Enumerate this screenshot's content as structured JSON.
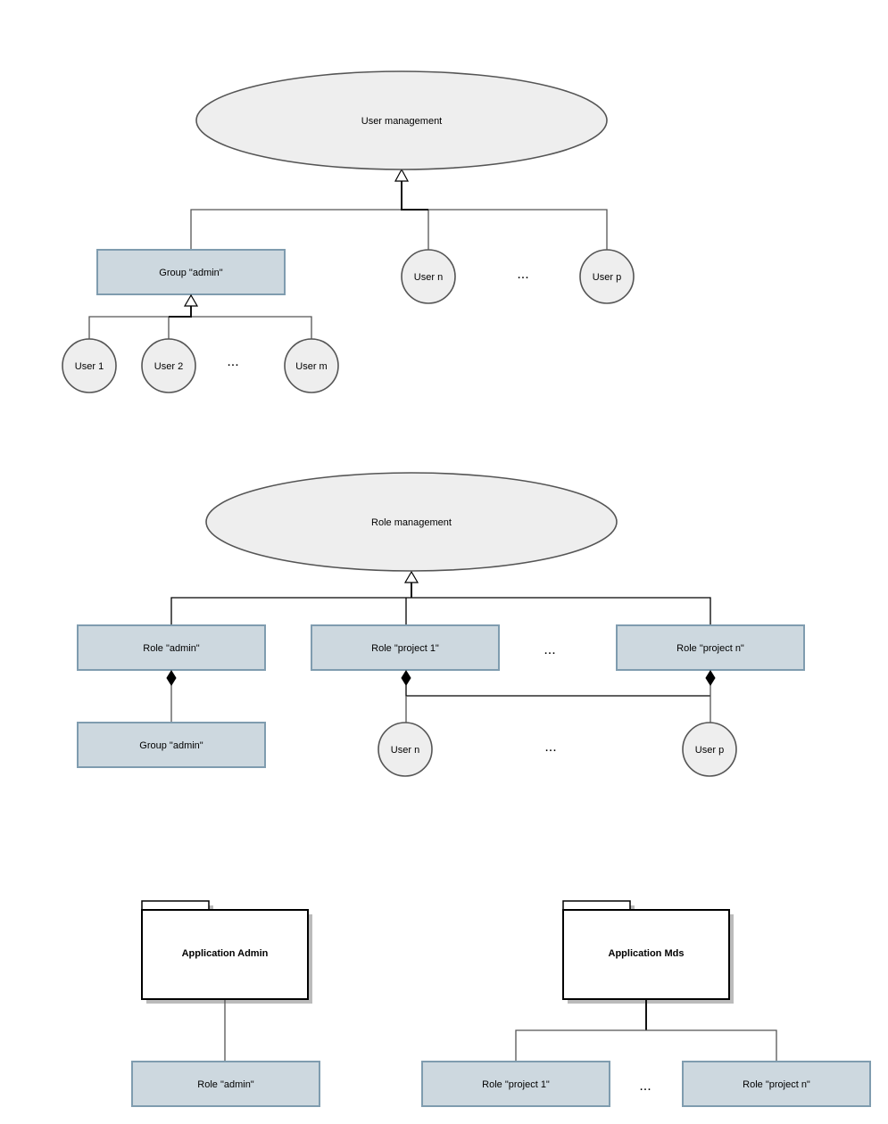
{
  "user_management": {
    "root": "User management",
    "group": "Group \"admin\"",
    "group_members": [
      "User 1",
      "User 2",
      "User m"
    ],
    "group_ellipsis": "...",
    "direct_users": [
      "User n",
      "User p"
    ],
    "direct_ellipsis": "..."
  },
  "role_management": {
    "root": "Role management",
    "roles": [
      "Role \"admin\"",
      "Role \"project 1\"",
      "Role \"project n\""
    ],
    "roles_ellipsis": "...",
    "admin_group": "Group \"admin\"",
    "users": [
      "User n",
      "User p"
    ],
    "users_ellipsis": "..."
  },
  "applications": [
    {
      "name": "Application Admin",
      "roles": [
        "Role \"admin\""
      ]
    },
    {
      "name": "Application Mds",
      "roles": [
        "Role \"project 1\"",
        "Role \"project n\""
      ],
      "ellipsis": "..."
    }
  ],
  "colors": {
    "node_fill": "#cdd8df",
    "node_border": "#7f9caf",
    "ellipse_fill": "#eeeeee",
    "outline": "#555555"
  }
}
